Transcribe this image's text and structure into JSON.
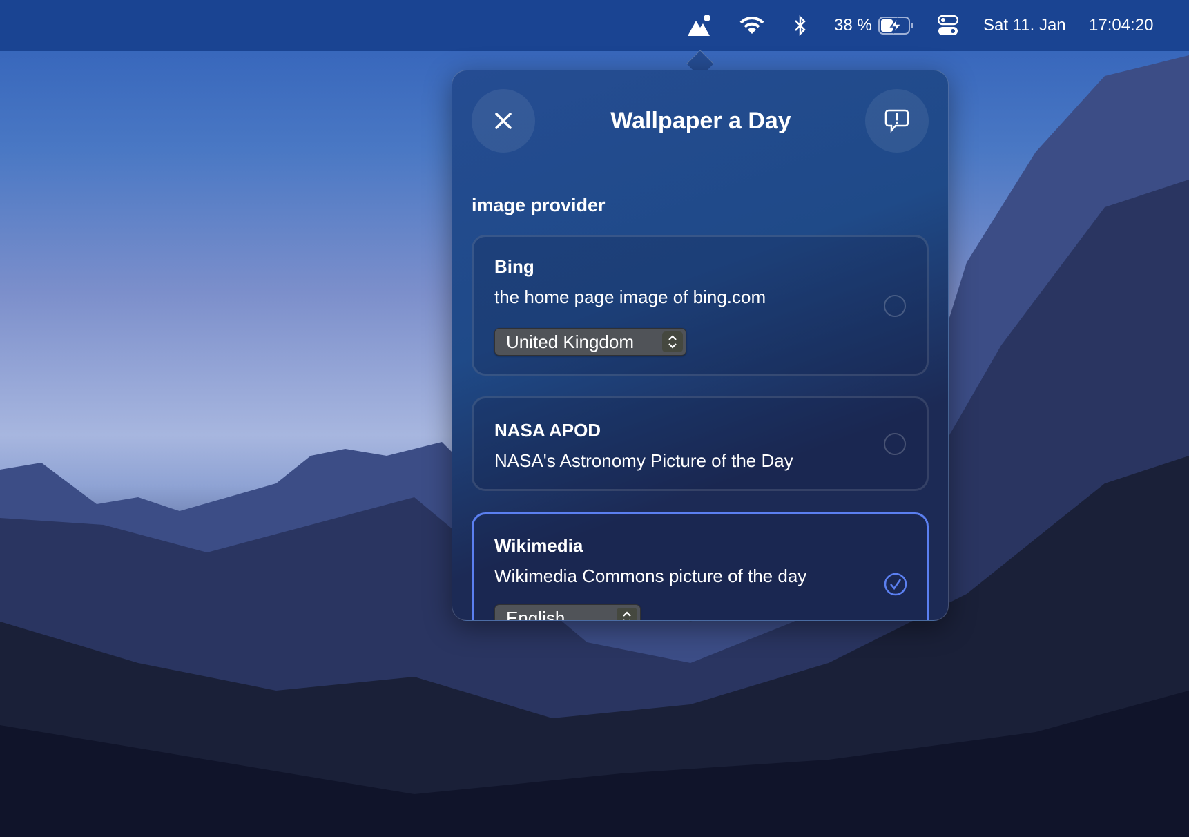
{
  "menubar": {
    "battery_percent_label": "38 %",
    "battery_level": 0.38,
    "date": "Sat 11. Jan",
    "time": "17:04:20",
    "icons": [
      "wallpaper-app-icon",
      "wifi-icon",
      "bluetooth-icon",
      "battery-charging-icon",
      "control-center-icon"
    ]
  },
  "popup": {
    "title": "Wallpaper a Day",
    "section_label": "image provider",
    "providers": [
      {
        "name": "Bing",
        "description": "the home page image of bing.com",
        "selected": false,
        "option": "United Kingdom"
      },
      {
        "name": "NASA APOD",
        "description": "NASA's Astronomy Picture of the Day",
        "selected": false
      },
      {
        "name": "Wikimedia",
        "description": "Wikimedia Commons picture of the day",
        "selected": true,
        "option": "English"
      }
    ]
  },
  "colors": {
    "menubar": "#1a4492",
    "accent": "#5b7ff0"
  }
}
